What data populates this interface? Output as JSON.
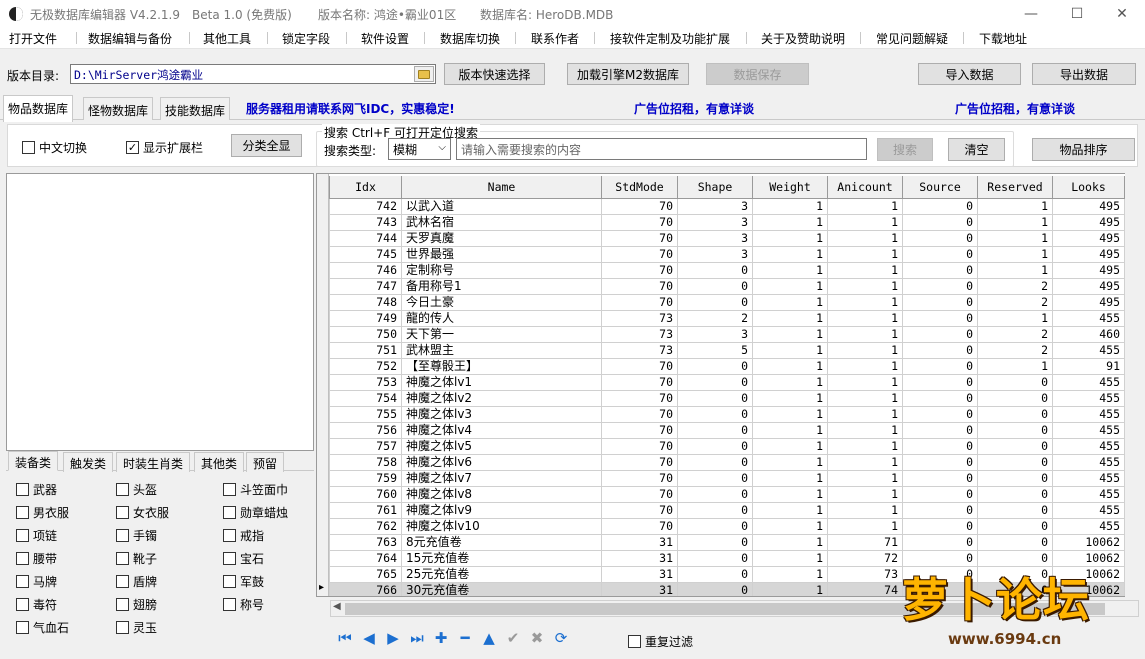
{
  "window": {
    "app_title": "无极数据库编辑器 V4.2.1.9",
    "edition": "Beta 1.0 (免费版)",
    "version_name": "版本名称: 鸿途•霸业01区",
    "db_name": "数据库名: HeroDB.MDB",
    "minimize": "—",
    "maximize": "☐",
    "close": "✕"
  },
  "menu": [
    "打开文件",
    "数据编辑与备份",
    "其他工具",
    "锁定字段",
    "软件设置",
    "数据库切换",
    "联系作者",
    "接软件定制及功能扩展",
    "关于及赞助说明",
    "常见问题解疑",
    "下载地址"
  ],
  "toolbar": {
    "version_dir_label": "版本目录:",
    "version_dir_value": "D:\\MirServer鸿途霸业",
    "quick_select": "版本快速选择",
    "load_engine": "加载引擎M2数据库",
    "save_data": "数据保存",
    "import_data": "导入数据",
    "export_data": "导出数据"
  },
  "tabs": [
    "物品数据库",
    "怪物数据库",
    "技能数据库"
  ],
  "ads": {
    "server_ad": "服务器租用请联系网飞IDC，实惠稳定!",
    "ad1": "广告位招租，有意详谈",
    "ad2": "广告位招租，有意详谈"
  },
  "options": {
    "chinese_switch": "中文切换",
    "show_ext": "显示扩展栏",
    "show_all": "分类全显",
    "chinese_checked": false,
    "ext_checked": true
  },
  "search": {
    "group_title": "搜索  Ctrl+F 可打开定位搜索",
    "type_label": "搜索类型:",
    "type_value": "模糊",
    "placeholder": "请输入需要搜索的内容",
    "search_btn": "搜索",
    "clear_btn": "清空",
    "sort_btn": "物品排序"
  },
  "category_tabs": [
    "装备类",
    "触发类",
    "时装生肖类",
    "其他类",
    "预留"
  ],
  "categories": [
    [
      "武器",
      "头盔",
      "斗笠面巾"
    ],
    [
      "男衣服",
      "女衣服",
      "勋章蜡烛"
    ],
    [
      "项链",
      "手镯",
      "戒指"
    ],
    [
      "腰带",
      "靴子",
      "宝石"
    ],
    [
      "马牌",
      "盾牌",
      "军鼓"
    ],
    [
      "毒符",
      "翅膀",
      "称号"
    ],
    [
      "气血石",
      "灵玉",
      ""
    ]
  ],
  "grid": {
    "columns": [
      "Idx",
      "Name",
      "StdMode",
      "Shape",
      "Weight",
      "Anicount",
      "Source",
      "Reserved",
      "Looks"
    ],
    "rows": [
      [
        "742",
        "以武入道",
        "70",
        "3",
        "1",
        "1",
        "0",
        "1",
        "495"
      ],
      [
        "743",
        "武林名宿",
        "70",
        "3",
        "1",
        "1",
        "0",
        "1",
        "495"
      ],
      [
        "744",
        "天罗真魔",
        "70",
        "3",
        "1",
        "1",
        "0",
        "1",
        "495"
      ],
      [
        "745",
        "世界最强",
        "70",
        "3",
        "1",
        "1",
        "0",
        "1",
        "495"
      ],
      [
        "746",
        "定制称号",
        "70",
        "0",
        "1",
        "1",
        "0",
        "1",
        "495"
      ],
      [
        "747",
        "备用称号1",
        "70",
        "0",
        "1",
        "1",
        "0",
        "2",
        "495"
      ],
      [
        "748",
        "今日土豪",
        "70",
        "0",
        "1",
        "1",
        "0",
        "2",
        "495"
      ],
      [
        "749",
        "龍的传人",
        "73",
        "2",
        "1",
        "1",
        "0",
        "1",
        "455"
      ],
      [
        "750",
        "天下第一",
        "73",
        "3",
        "1",
        "1",
        "0",
        "2",
        "460"
      ],
      [
        "751",
        "武林盟主",
        "73",
        "5",
        "1",
        "1",
        "0",
        "2",
        "455"
      ],
      [
        "752",
        "【至尊骰王】",
        "70",
        "0",
        "1",
        "1",
        "0",
        "1",
        "91"
      ],
      [
        "753",
        "神魔之体lv1",
        "70",
        "0",
        "1",
        "1",
        "0",
        "0",
        "455"
      ],
      [
        "754",
        "神魔之体lv2",
        "70",
        "0",
        "1",
        "1",
        "0",
        "0",
        "455"
      ],
      [
        "755",
        "神魔之体lv3",
        "70",
        "0",
        "1",
        "1",
        "0",
        "0",
        "455"
      ],
      [
        "756",
        "神魔之体lv4",
        "70",
        "0",
        "1",
        "1",
        "0",
        "0",
        "455"
      ],
      [
        "757",
        "神魔之体lv5",
        "70",
        "0",
        "1",
        "1",
        "0",
        "0",
        "455"
      ],
      [
        "758",
        "神魔之体lv6",
        "70",
        "0",
        "1",
        "1",
        "0",
        "0",
        "455"
      ],
      [
        "759",
        "神魔之体lv7",
        "70",
        "0",
        "1",
        "1",
        "0",
        "0",
        "455"
      ],
      [
        "760",
        "神魔之体lv8",
        "70",
        "0",
        "1",
        "1",
        "0",
        "0",
        "455"
      ],
      [
        "761",
        "神魔之体lv9",
        "70",
        "0",
        "1",
        "1",
        "0",
        "0",
        "455"
      ],
      [
        "762",
        "神魔之体lv10",
        "70",
        "0",
        "1",
        "1",
        "0",
        "0",
        "455"
      ],
      [
        "763",
        "8元充值卷",
        "31",
        "0",
        "1",
        "71",
        "0",
        "0",
        "10062"
      ],
      [
        "764",
        "15元充值卷",
        "31",
        "0",
        "1",
        "72",
        "0",
        "0",
        "10062"
      ],
      [
        "765",
        "25元充值卷",
        "31",
        "0",
        "1",
        "73",
        "0",
        "0",
        "10062"
      ],
      [
        "766",
        "30元充值卷",
        "31",
        "0",
        "1",
        "74",
        "0",
        "0",
        "10062"
      ]
    ],
    "selected_index": 24
  },
  "navigator": {
    "icons": [
      {
        "name": "first-record-icon",
        "glyph": "⏮",
        "disabled": false
      },
      {
        "name": "prior-record-icon",
        "glyph": "◀",
        "disabled": false
      },
      {
        "name": "next-record-icon",
        "glyph": "▶",
        "disabled": false
      },
      {
        "name": "last-record-icon",
        "glyph": "⏭",
        "disabled": false
      },
      {
        "name": "insert-record-icon",
        "glyph": "✚",
        "disabled": false
      },
      {
        "name": "delete-record-icon",
        "glyph": "━",
        "disabled": false
      },
      {
        "name": "edit-record-icon",
        "glyph": "▲",
        "disabled": false
      },
      {
        "name": "post-record-icon",
        "glyph": "✔",
        "disabled": true
      },
      {
        "name": "cancel-record-icon",
        "glyph": "✖",
        "disabled": true
      },
      {
        "name": "refresh-record-icon",
        "glyph": "⟳",
        "disabled": false
      }
    ],
    "dedupe_label": "重复过滤"
  },
  "watermark": {
    "text": "萝卜论坛",
    "url": "www.6994.cn"
  }
}
